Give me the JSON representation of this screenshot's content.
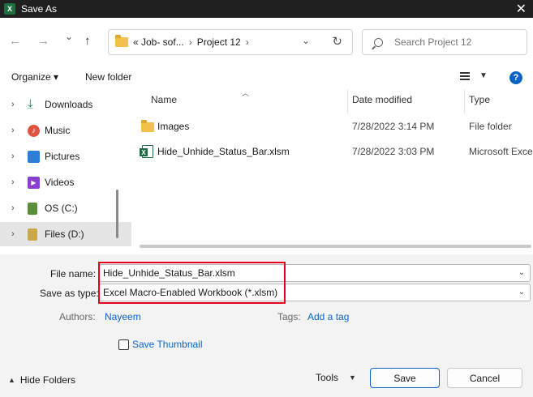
{
  "window": {
    "title": "Save As",
    "app_icon": "excel-icon",
    "close_glyph": "✕"
  },
  "nav": {
    "back_glyph": "←",
    "forward_glyph": "→",
    "recent_glyph": "⌄",
    "up_glyph": "↑",
    "breadcrumb": [
      "«  Job- sof...",
      "Project 12"
    ],
    "breadcrumb_sep": "›",
    "refresh_glyph": "↻",
    "search_placeholder": "Search Project 12"
  },
  "toolbar": {
    "organize": "Organize ▾",
    "new_folder": "New folder",
    "help": "?"
  },
  "sidebar": {
    "items": [
      {
        "label": "Downloads",
        "icon": "download-icon",
        "color": "#1f8a4c"
      },
      {
        "label": "Music",
        "icon": "music-icon",
        "color": "#e0533e"
      },
      {
        "label": "Pictures",
        "icon": "pictures-icon",
        "color": "#2b7fd8"
      },
      {
        "label": "Videos",
        "icon": "videos-icon",
        "color": "#8a3fd1"
      },
      {
        "label": "OS (C:)",
        "icon": "drive-icon",
        "color": "#5a8f3a"
      },
      {
        "label": "Files (D:)",
        "icon": "drive-icon",
        "color": "#c8a84a"
      }
    ]
  },
  "files": {
    "columns": {
      "name": "Name",
      "date": "Date modified",
      "type": "Type"
    },
    "rows": [
      {
        "name": "Images",
        "date": "7/28/2022 3:14 PM",
        "type": "File folder",
        "icon": "folder-icon"
      },
      {
        "name": "Hide_Unhide_Status_Bar.xlsm",
        "date": "7/28/2022 3:03 PM",
        "type": "Microsoft Exce",
        "icon": "excel-file-icon"
      }
    ]
  },
  "form": {
    "file_name_label": "File name:",
    "file_name_value": "Hide_Unhide_Status_Bar.xlsm",
    "save_type_label": "Save as type:",
    "save_type_value": "Excel Macro-Enabled Workbook (*.xlsm)",
    "authors_label": "Authors:",
    "authors_value": "Nayeem",
    "tags_label": "Tags:",
    "tags_value": "Add a tag",
    "thumbnail_label": "Save Thumbnail",
    "highlight_color": "#e4001c"
  },
  "footer": {
    "hide_folders": "Hide Folders",
    "tools": "Tools",
    "save": "Save",
    "cancel": "Cancel"
  }
}
